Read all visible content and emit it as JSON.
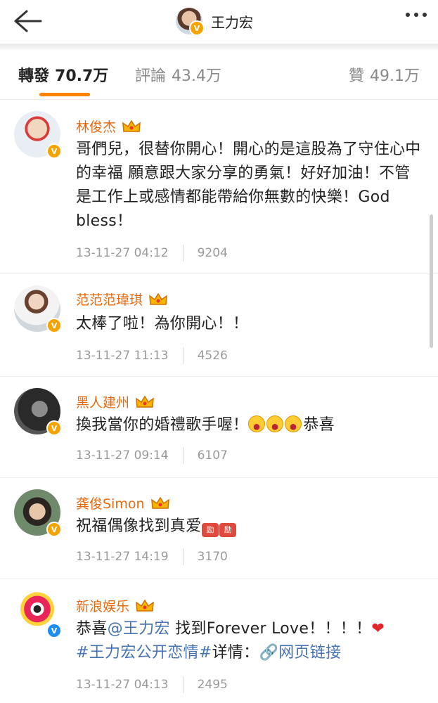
{
  "header": {
    "title": "王力宏",
    "back_icon": "back-arrow-icon",
    "more_icon": "more-dots-icon"
  },
  "tabs": [
    {
      "label": "轉發",
      "count": "70.7万",
      "active": true
    },
    {
      "label": "評論",
      "count": "43.4万",
      "active": false
    },
    {
      "label": "贊",
      "count": "49.1万",
      "active": false
    }
  ],
  "accent_color": "#ff8200",
  "name_color": "#e86a0f",
  "comments": [
    {
      "user": "林俊杰",
      "verified": "gold",
      "text": "哥們兒，很替你開心！開心的是這股為了守住心中的幸福 願意跟大家分享的勇氣！好好加油！不管是工作上或感情都能帶給你無數的快樂！God bless！",
      "time": "13-11-27 04:12",
      "reposts": "9204"
    },
    {
      "user": "范范范瑋琪",
      "verified": "gold",
      "text": "太棒了啦！為你開心！！",
      "time": "13-11-27 11:13",
      "reposts": "4526"
    },
    {
      "user": "黑人建州",
      "verified": "gold",
      "text": "換我當你的婚禮歌手喔！",
      "text_after": "恭喜",
      "emoji": "laughing-emoji",
      "time": "13-11-27 09:14",
      "reposts": "6107"
    },
    {
      "user": "龚俊Simon",
      "verified": "gold",
      "text": "祝福偶像找到真爱",
      "sticker": "励",
      "time": "13-11-27 14:19",
      "reposts": "3170"
    },
    {
      "user": "新浪娱乐",
      "verified": "blue",
      "text_a": "恭喜",
      "mention": "@王力宏",
      "text_b": " 找到Forever Love！！！！",
      "hashtag": "#王力宏公开恋情#",
      "text_c": "详情：",
      "link_label": "网页链接",
      "time": "13-11-27 04:13",
      "reposts": "2495"
    }
  ]
}
